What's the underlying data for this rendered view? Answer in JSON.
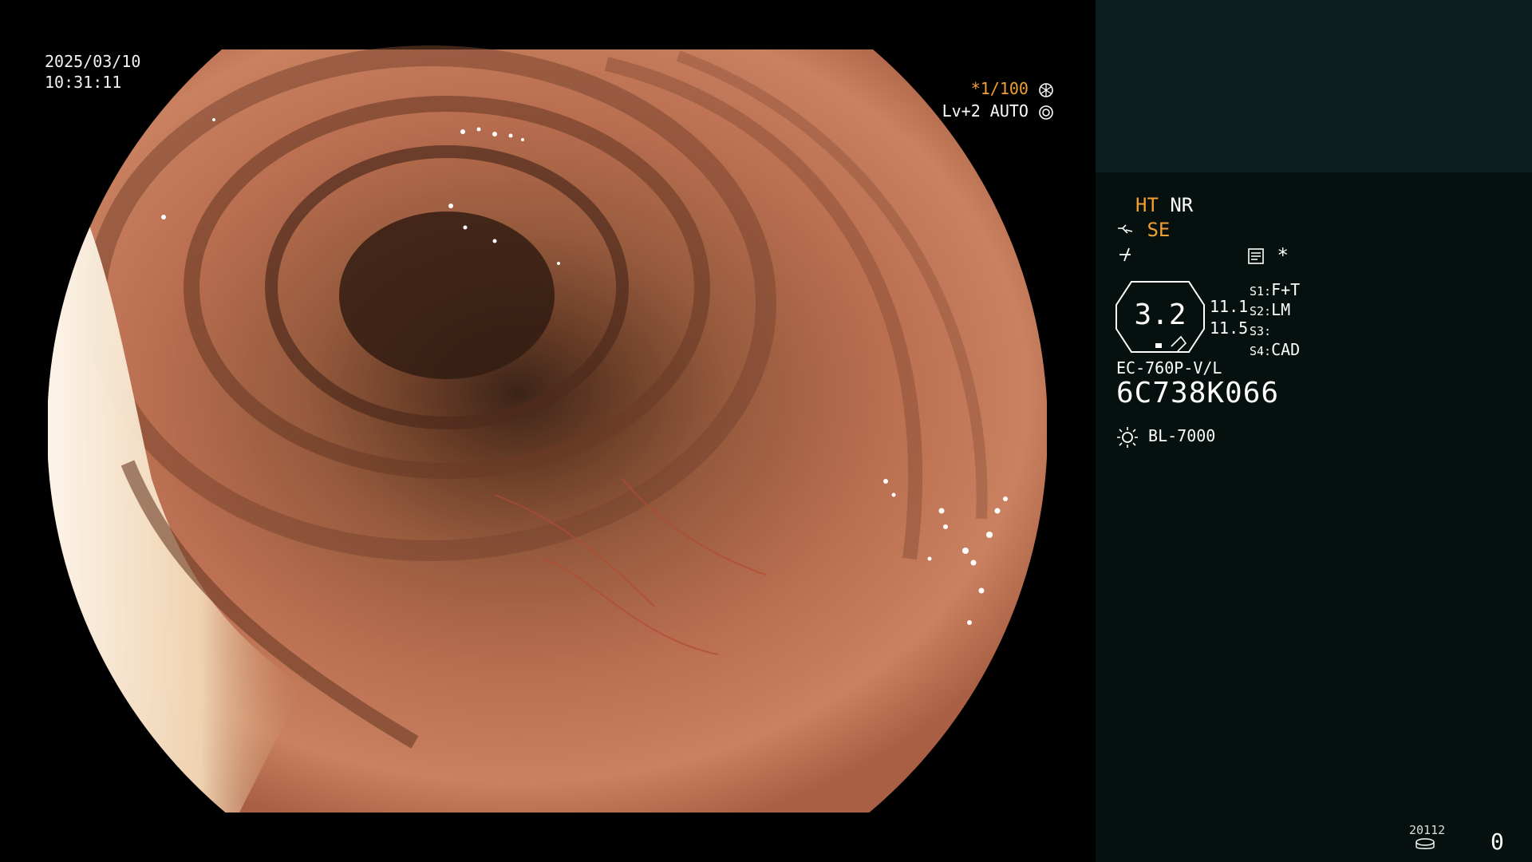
{
  "overlay": {
    "date": "2025/03/10",
    "time": "10:31:11",
    "shutter": "*1/100",
    "level_auto": "Lv+2 AUTO"
  },
  "sidebar": {
    "ht": "HT",
    "nr": "NR",
    "se": "SE",
    "star": "*",
    "gauge_value": "3.2",
    "val1": "11.1",
    "val2": "11.5",
    "s1_label": "S1:",
    "s1_value": "F+T",
    "s2_label": "S2:",
    "s2_value": "LM",
    "s3_label": "S3:",
    "s3_value": "",
    "s4_label": "S4:",
    "s4_value": "CAD",
    "scope_model": "EC-760P-V/L",
    "serial": "6C738K066",
    "light_source": "BL-7000",
    "footer_code": "20112",
    "footer_count": "0"
  },
  "colors": {
    "accent_orange": "#f0a030",
    "panel_dark": "#06100f",
    "panel_top": "#0c1f20",
    "tissue": "#b5684a"
  },
  "icons": [
    "aperture-icon",
    "iris-icon",
    "scope-tip-icon",
    "enhance-icon",
    "memo-icon",
    "lamp-icon",
    "disk-icon"
  ]
}
